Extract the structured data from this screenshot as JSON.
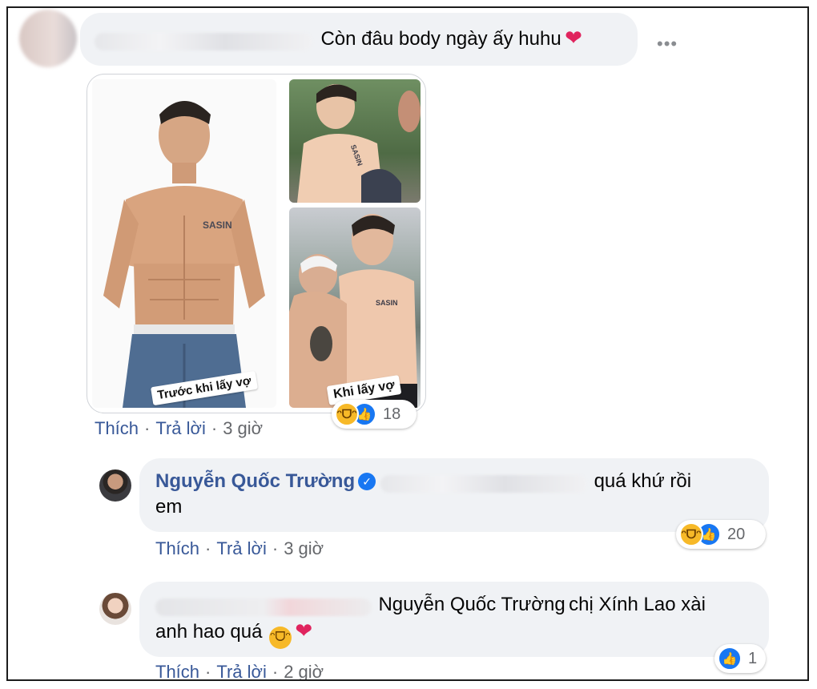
{
  "comment1": {
    "text": "Còn đâu body ngày ấy huhu",
    "more_label": "•••",
    "photo": {
      "caption_before": "Trước khi lấy vợ",
      "caption_after": "Khi lấy vợ",
      "tattoo": "SASIN"
    },
    "actions": {
      "like": "Thích",
      "reply": "Trả lời",
      "time": "3 giờ"
    },
    "reactions": {
      "types": [
        "haha",
        "like"
      ],
      "count": "18"
    }
  },
  "reply1": {
    "author": "Nguyễn Quốc Trường",
    "text_line1": "quá khứ rồi",
    "text_line2": "em",
    "actions": {
      "like": "Thích",
      "reply": "Trả lời",
      "time": "3 giờ"
    },
    "reactions": {
      "types": [
        "haha",
        "like"
      ],
      "count": "20"
    }
  },
  "reply2": {
    "mention": "Nguyễn Quốc Trường",
    "text_line1_rest": "chị Xính Lao xài",
    "text_line2": "anh hao quá",
    "actions": {
      "like": "Thích",
      "reply": "Trả lời",
      "time": "2 giờ"
    },
    "reactions": {
      "types": [
        "like"
      ],
      "count": "1"
    }
  },
  "colors": {
    "bubble": "#f0f2f5",
    "link": "#385898",
    "meta": "#65676b",
    "like_blue": "#1877f2",
    "haha_yellow": "#f7b928",
    "heart_red": "#e0245e"
  }
}
